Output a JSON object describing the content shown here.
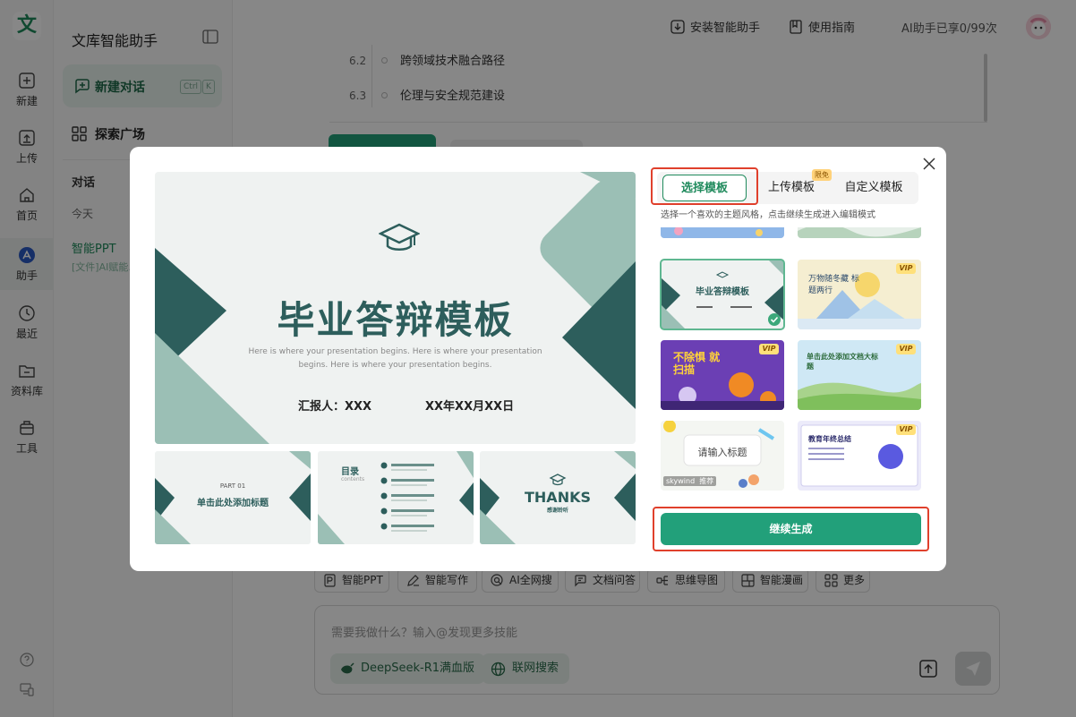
{
  "app": {
    "logo_char": "文",
    "panel_title": "文库智能助手"
  },
  "rail": {
    "items": [
      {
        "label": "新建",
        "icon": "plus-icon"
      },
      {
        "label": "上传",
        "icon": "upload-icon"
      },
      {
        "label": "首页",
        "icon": "home-icon"
      },
      {
        "label": "助手",
        "icon": "assistant-icon"
      },
      {
        "label": "最近",
        "icon": "clock-icon"
      },
      {
        "label": "资料库",
        "icon": "folder-icon"
      },
      {
        "label": "工具",
        "icon": "toolbox-icon"
      }
    ],
    "active_index": 3
  },
  "sidebar": {
    "new_chat": {
      "label": "新建对话",
      "kbd_ctrl": "Ctrl",
      "kbd_key": "K"
    },
    "explore": {
      "label": "探索广场"
    },
    "section": "对话",
    "today": "今天",
    "conversation": {
      "title": "智能PPT",
      "subtitle": "[文件]AI赋能..."
    }
  },
  "topbar": {
    "install": "安装智能助手",
    "guide": "使用指南",
    "quota": "AI助手已享0/99次"
  },
  "outline": [
    {
      "num": "6.2",
      "text": "跨领域技术融合路径"
    },
    {
      "num": "6.3",
      "text": "伦理与安全规范建设"
    }
  ],
  "chips": [
    "智能PPT",
    "智能写作",
    "AI全网搜",
    "文档问答",
    "思维导图",
    "智能漫画",
    "更多"
  ],
  "composer": {
    "placeholder": "需要我做什么？输入@发现更多技能",
    "model": "DeepSeek-R1满血版",
    "web": "联网搜索"
  },
  "modal": {
    "tabs": [
      {
        "label": "选择模板",
        "active": true
      },
      {
        "label": "上传模板",
        "badge": "限免"
      },
      {
        "label": "自定义模板"
      }
    ],
    "hint": "选择一个喜欢的主题风格，点击继续生成进入编辑模式",
    "preview": {
      "title": "毕业答辩模板",
      "desc": "Here is where your presentation begins. Here is where your presentation begins. Here is where your presentation begins.",
      "reporter": "汇报人：XXX",
      "date": "XX年XX月XX日"
    },
    "thumbs": [
      {
        "part": "PART 01",
        "text": "单击此处添加标题"
      },
      {
        "text": "目录",
        "sub": "contents"
      },
      {
        "text": "THANKS",
        "sub": "感谢聆听"
      }
    ],
    "cards": [
      {
        "title": "毕业答辩模板",
        "selected": true
      },
      {
        "title": "万物随冬藏 标题两行",
        "vip": "VIP"
      },
      {
        "title": "不除惧 就扫描",
        "vip": "VIP"
      },
      {
        "title": "单击此处添加文档大标题",
        "vip": "VIP"
      },
      {
        "title": "请输入标题",
        "mark": "skywind  推荐"
      },
      {
        "title": "教育年终总结",
        "vip": "VIP"
      }
    ],
    "continue": "继续生成"
  },
  "colors": {
    "brand": "#1f8a5c",
    "template_dark": "#2d5e5c",
    "template_light": "#9bbfb5",
    "highlight": "#e0402c",
    "primary_button": "#22a07a"
  }
}
